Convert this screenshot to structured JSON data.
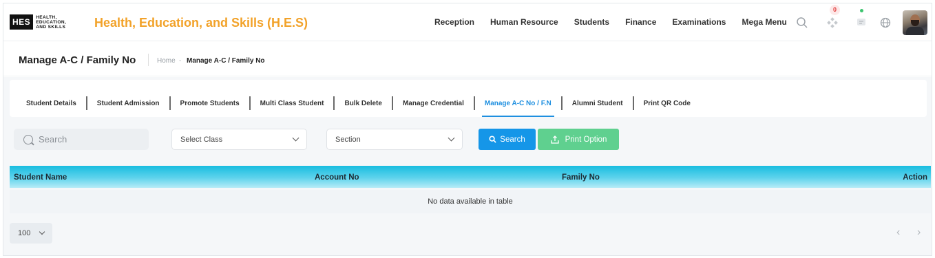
{
  "brand": {
    "logo_box": "HES",
    "logo_lines": [
      "HEALTH,",
      "EDUCATION,",
      "AND SKILLS"
    ],
    "title": "Health, Education, and Skills (H.E.S)",
    "title_color": "#f2a229"
  },
  "nav": {
    "items": [
      "Reception",
      "Human Resource",
      "Students",
      "Finance",
      "Examinations",
      "Mega Menu"
    ]
  },
  "toolbar": {
    "notification_count": "0",
    "icons": [
      "search-icon",
      "apps-icon",
      "chat-icon",
      "globe-icon",
      "avatar"
    ]
  },
  "page": {
    "title": "Manage A-C / Family No",
    "breadcrumb_home": "Home",
    "breadcrumb_sep": "-",
    "breadcrumb_current": "Manage A-C / Family No"
  },
  "tabs": [
    {
      "label": "Student Details",
      "active": false
    },
    {
      "label": "Student Admission",
      "active": false
    },
    {
      "label": "Promote Students",
      "active": false
    },
    {
      "label": "Multi Class Student",
      "active": false
    },
    {
      "label": "Bulk Delete",
      "active": false
    },
    {
      "label": "Manage Credential",
      "active": false
    },
    {
      "label": "Manage A-C No / F.N",
      "active": true
    },
    {
      "label": "Alumni Student",
      "active": false
    },
    {
      "label": "Print QR Code",
      "active": false
    }
  ],
  "filters": {
    "search_placeholder": "Search",
    "class_select": "Select Class",
    "section_select": "Section",
    "search_button": "Search",
    "print_button": "Print Option"
  },
  "table": {
    "columns": [
      "Student Name",
      "Account No",
      "Family No",
      "Action"
    ],
    "empty_message": "No data available in table"
  },
  "pagination": {
    "page_size": "100",
    "prev": "‹",
    "next": "›"
  },
  "colors": {
    "accent_blue": "#1596e8",
    "print_green": "#5fd08f",
    "table_head": "#18bde0"
  }
}
